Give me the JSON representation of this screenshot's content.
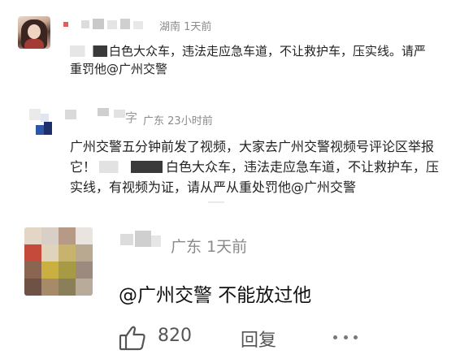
{
  "comments": [
    {
      "location": "湖南",
      "time": "1天前",
      "text_lead": "白色大众车，违法走应急车道，不让救护车，压实线。请严重罚他@广州交警"
    },
    {
      "name_tail": "字",
      "location": "广东",
      "time": "23小时前",
      "text_a": "广州交警五分钟前发了视频，大家去广州交警视频号评论区举报它！",
      "text_b": "白色大众车，违法走应急车道，不让救护车，压实线，有视频为证，请从严从重处罚他@广州交警"
    },
    {
      "location": "广东",
      "time": "1天前",
      "text": "@广州交警  不能放过他",
      "likes": "820",
      "reply_label": "回复"
    }
  ],
  "icons": {
    "like": "thumbs-up-icon",
    "more": "more-dots-icon"
  },
  "colors": {
    "meta_gray": "#8a8a8a",
    "text": "#222222"
  }
}
